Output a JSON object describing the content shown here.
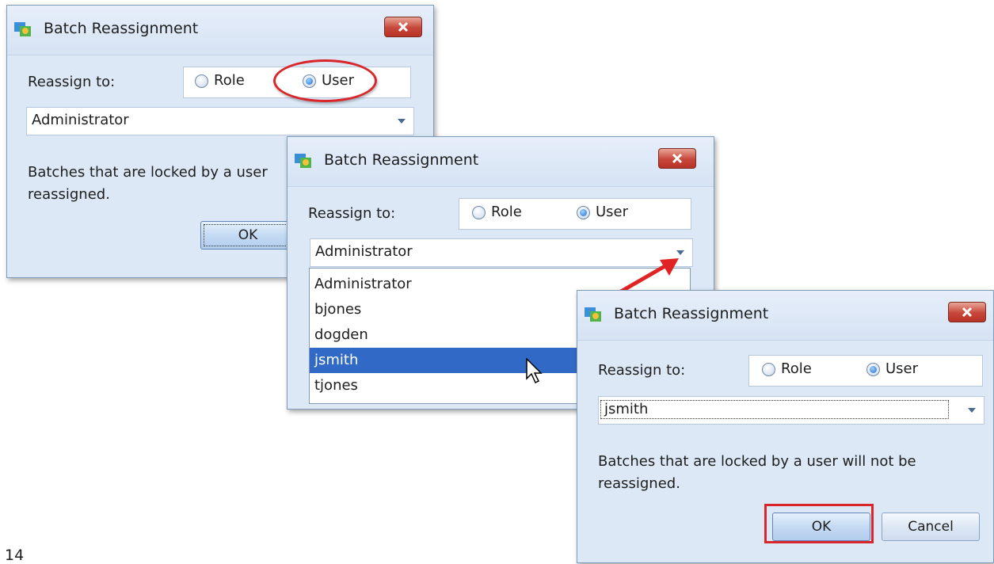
{
  "dialogs": [
    {
      "title": "Batch Reassignment",
      "reassign_label": "Reassign to:",
      "role_label": "Role",
      "user_label": "User",
      "selected_value": "Administrator",
      "info_text_line1": "Batches that are locked by a user",
      "info_text_line2": "reassigned.",
      "ok_label": "OK"
    },
    {
      "title": "Batch Reassignment",
      "reassign_label": "Reassign to:",
      "role_label": "Role",
      "user_label": "User",
      "selected_value": "Administrator",
      "dropdown_options": [
        "Administrator",
        "bjones",
        "dogden",
        "jsmith",
        "tjones"
      ],
      "hovered_option": "jsmith"
    },
    {
      "title": "Batch Reassignment",
      "reassign_label": "Reassign to:",
      "role_label": "Role",
      "user_label": "User",
      "selected_value": "jsmith",
      "info_text_line1": "Batches that are locked by a user will not be",
      "info_text_line2": "reassigned.",
      "ok_label": "OK",
      "cancel_label": "Cancel"
    }
  ],
  "page_number": "14",
  "colors": {
    "dialog_bg": "#dce8f6",
    "highlight_red": "#d9262a",
    "selection_blue": "#3169c6"
  }
}
